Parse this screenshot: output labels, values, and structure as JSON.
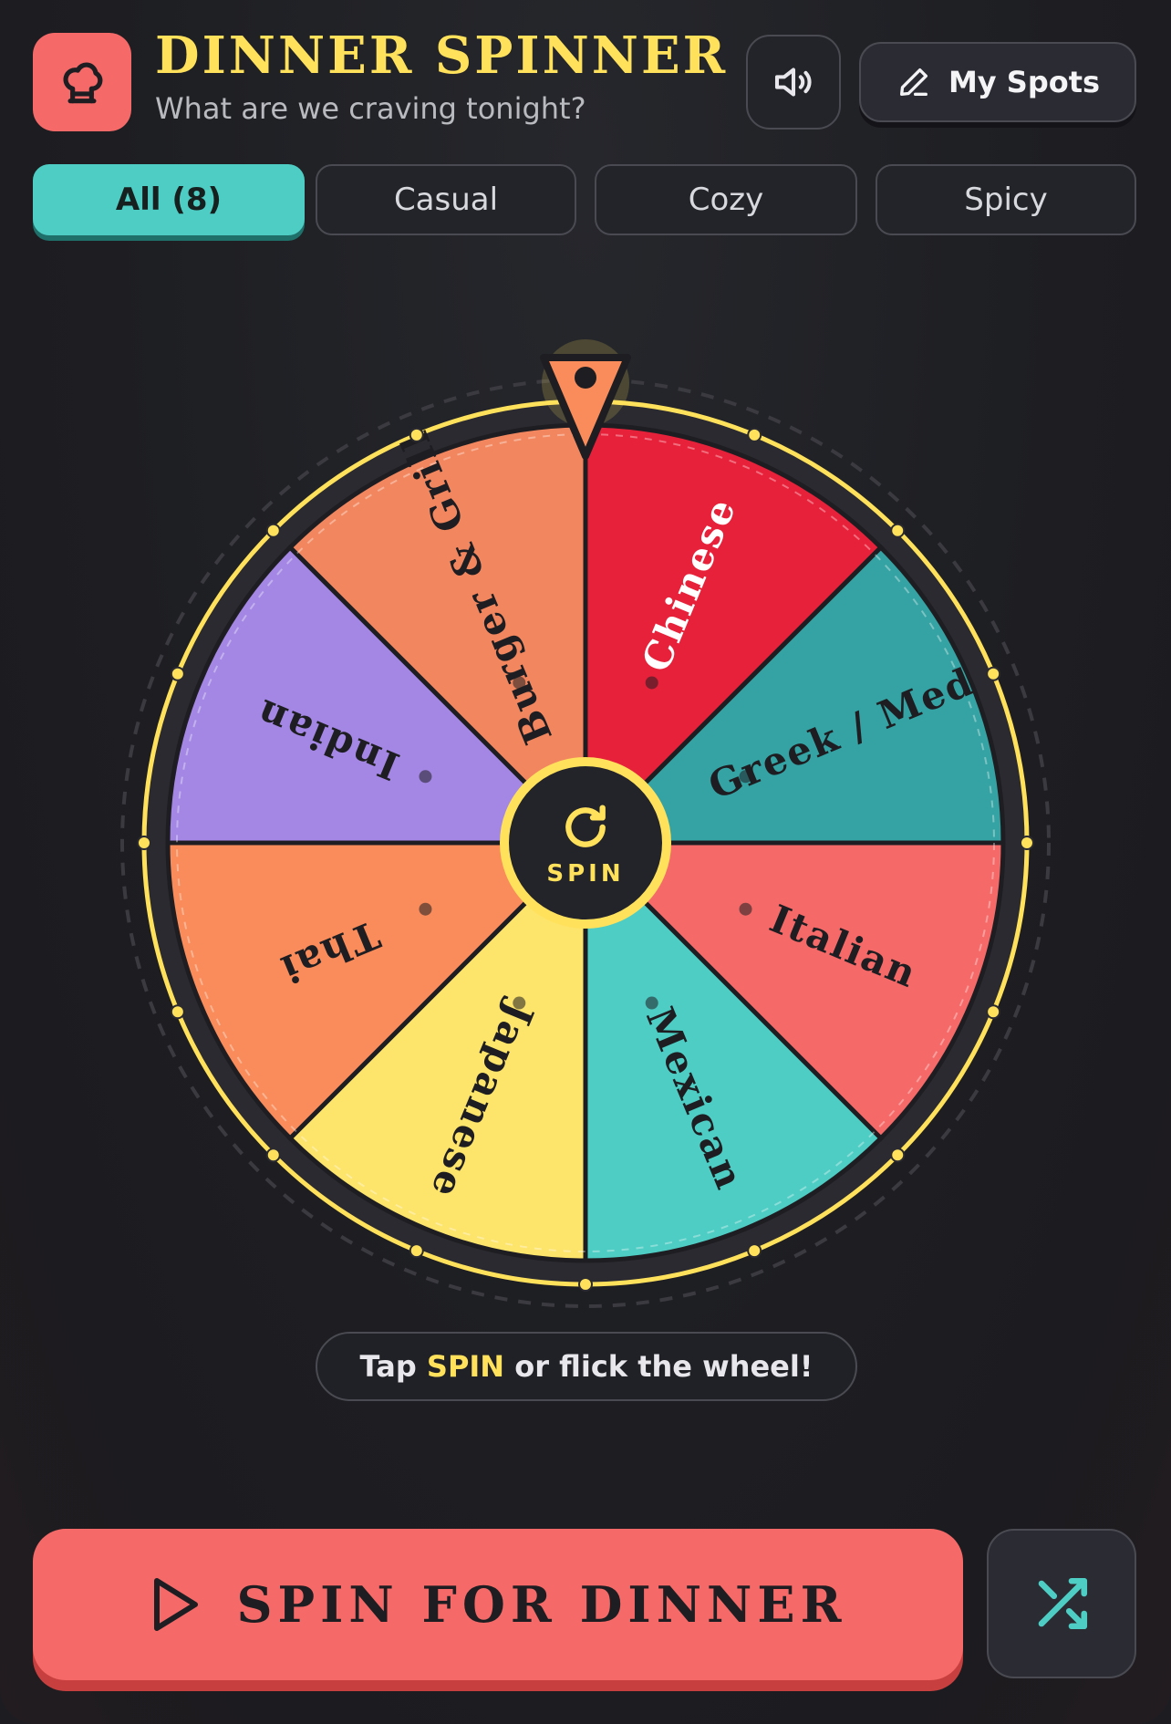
{
  "header": {
    "title": "DINNER SPINNER",
    "subtitle": "What are we craving tonight?",
    "logo_icon": "chef-hat-icon",
    "sound_icon": "speaker-icon",
    "spots_label": "My Spots",
    "spots_icon": "pencil-icon"
  },
  "tabs": [
    {
      "label": "All (8)",
      "active": true
    },
    {
      "label": "Casual",
      "active": false
    },
    {
      "label": "Cozy",
      "active": false
    },
    {
      "label": "Spicy",
      "active": false
    }
  ],
  "wheel": {
    "segments": [
      {
        "label": "Chinese",
        "color": "#e8213a",
        "text": "#ffffff"
      },
      {
        "label": "Greek / Med",
        "color": "#35a3a3",
        "text": "#1e1e22"
      },
      {
        "label": "Italian",
        "color": "#f56a68",
        "text": "#1e1e22"
      },
      {
        "label": "Mexican",
        "color": "#4ecdc4",
        "text": "#1e1e22"
      },
      {
        "label": "Japanese",
        "color": "#fde46a",
        "text": "#1e1e22"
      },
      {
        "label": "Thai",
        "color": "#f98c5a",
        "text": "#1e1e22"
      },
      {
        "label": "Indian",
        "color": "#a487e4",
        "text": "#1e1e22"
      },
      {
        "label": "Burger & Grill",
        "color": "#f2875f",
        "text": "#1e1e22"
      }
    ],
    "hub_label": "SPIN",
    "hub_icon": "refresh-icon",
    "pointer_icon": "pointer-icon"
  },
  "hint": {
    "pre": "Tap ",
    "highlight": "SPIN",
    "post": " or flick the wheel!"
  },
  "actions": {
    "spin_label": "SPIN FOR DINNER",
    "spin_icon": "play-icon",
    "shuffle_icon": "shuffle-icon"
  },
  "colors": {
    "accent_yellow": "#ffe15c",
    "accent_coral": "#f56a68",
    "accent_teal": "#4ecdc4",
    "background": "#1e1f23"
  }
}
